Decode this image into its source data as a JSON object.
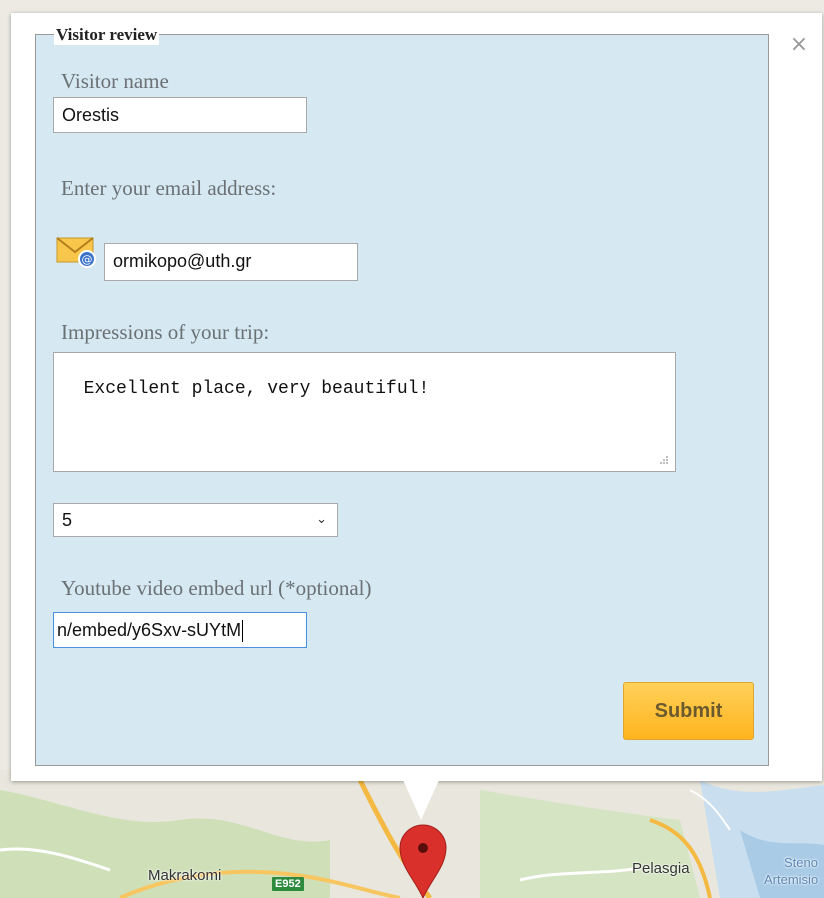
{
  "form": {
    "legend": "Visitor review",
    "name_label": "Visitor name",
    "name_value": "Orestis",
    "email_label": "Enter your email address:",
    "email_value": "ormikopo@uth.gr",
    "impressions_label": "Impressions of your trip:",
    "impressions_value": "Excellent place, very beautiful!",
    "rating_value": "5",
    "youtube_label": "Youtube video embed url (*optional)",
    "youtube_value": "n/embed/y6Sxv-sUYtM",
    "submit_label": "Submit",
    "close_glyph": "×"
  },
  "map": {
    "labels": [
      "Makrakomi",
      "Pelasgia",
      "Steno",
      "Artemisio"
    ],
    "road_badge": "E952",
    "marker_icon": "map-pin-icon"
  },
  "colors": {
    "form_background": "#d6e9f2",
    "submit_gradient_top": "#ffd15a",
    "submit_gradient_bottom": "#ffb41e",
    "marker": "#d9302b"
  }
}
